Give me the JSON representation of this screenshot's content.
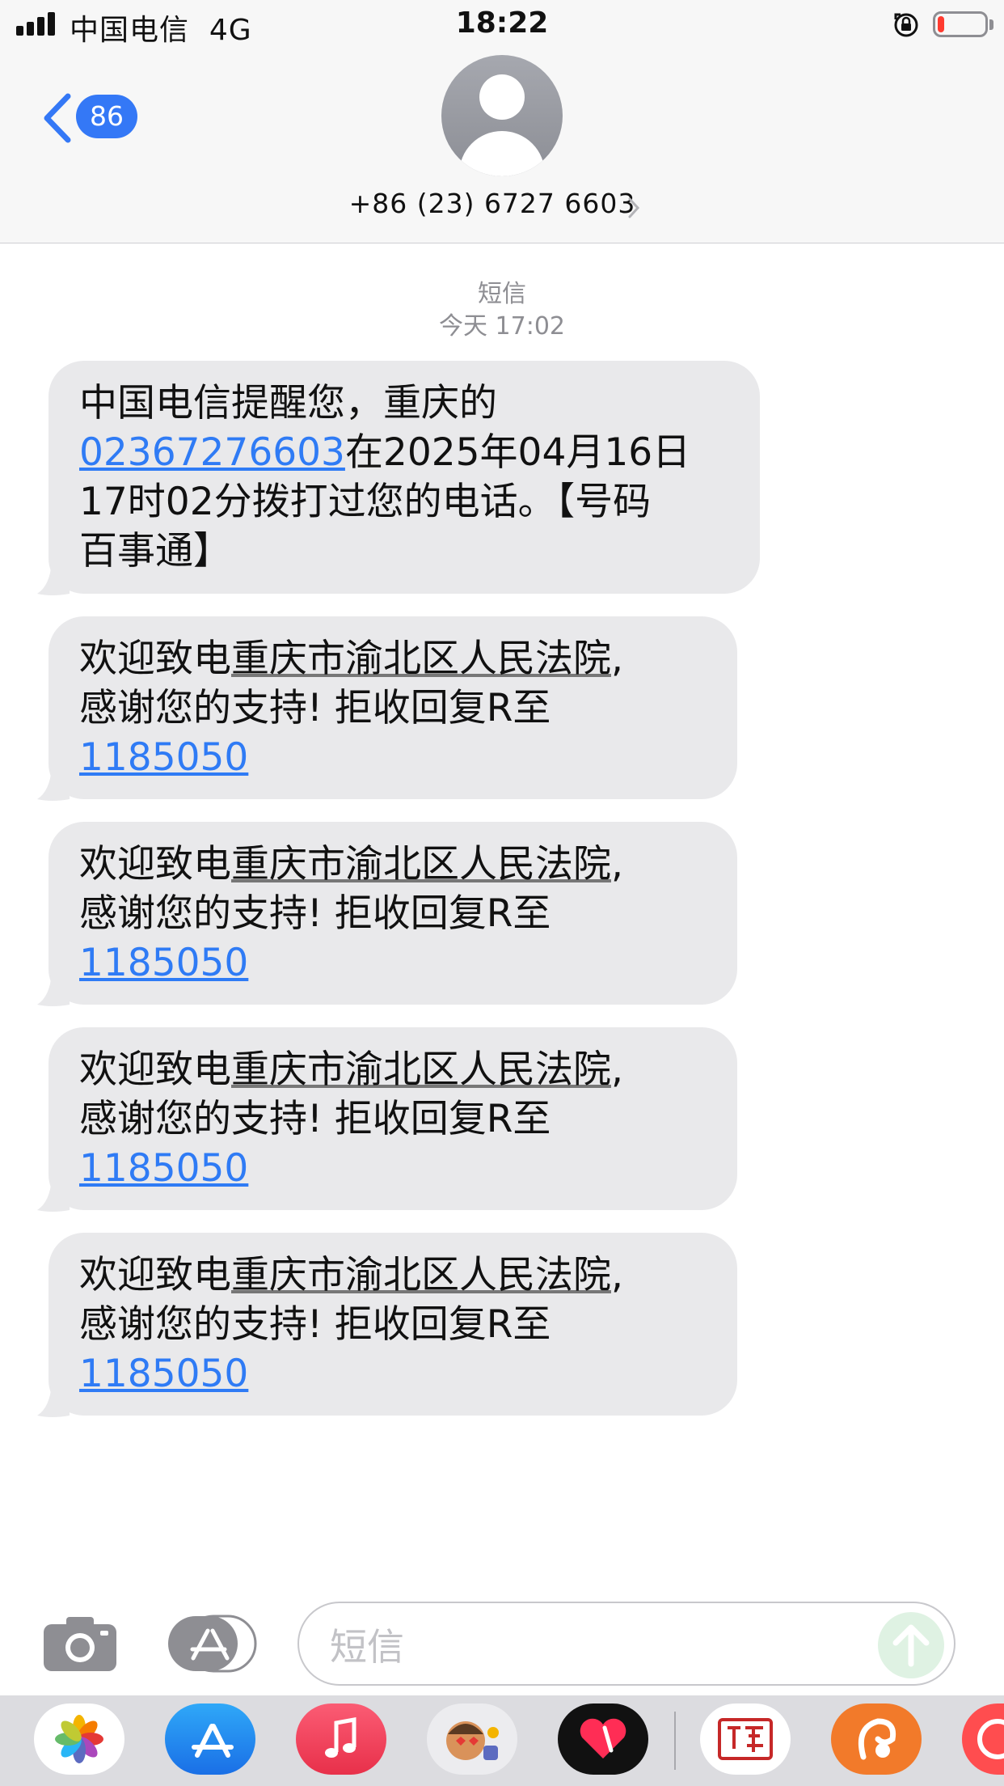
{
  "status_bar": {
    "carrier": "中国电信",
    "network": "4G",
    "time": "18:22",
    "battery_level": 0.15,
    "icons": [
      "signal-icon",
      "orientation-lock-icon",
      "battery-icon"
    ],
    "colors": {
      "battery_low": "#ff3b30"
    }
  },
  "header": {
    "back_badge": "86",
    "contact_number": "+86 (23) 6727 6603",
    "icons": [
      "back-chevron-icon",
      "avatar-icon",
      "chevron-right-icon"
    ],
    "colors": {
      "accent": "#3478f6"
    }
  },
  "conversation": {
    "type_label": "短信",
    "timestamp": "今天 17:02",
    "messages": [
      {
        "line1": "中国电信提醒您，重庆的",
        "link_number": "02367276603",
        "line2_rest": "在2025年04月16日",
        "line3": "17时02分拨打过您的电话。【号码",
        "line4": "百事通】"
      },
      {
        "prefix": "欢迎致电",
        "org": "重庆市渝北区人民法院",
        "suffix": ",",
        "line2": "感谢您的支持! 拒收回复R至",
        "link": "1185050"
      },
      {
        "prefix": "欢迎致电",
        "org": "重庆市渝北区人民法院",
        "suffix": ",",
        "line2": "感谢您的支持! 拒收回复R至",
        "link": "1185050"
      },
      {
        "prefix": "欢迎致电",
        "org": "重庆市渝北区人民法院",
        "suffix": ",",
        "line2": "感谢您的支持! 拒收回复R至",
        "link": "1185050"
      },
      {
        "prefix": "欢迎致电",
        "org": "重庆市渝北区人民法院",
        "suffix": ",",
        "line2": "感谢您的支持! 拒收回复R至",
        "link": "1185050"
      }
    ],
    "colors": {
      "bubble": "#e9e9eb",
      "link": "#2f7bf5"
    }
  },
  "compose": {
    "placeholder": "短信",
    "icons": [
      "camera-icon",
      "app-store-icon",
      "send-arrow-icon"
    ]
  },
  "app_drawer": {
    "apps": [
      "photos-app-icon",
      "app-store-app-icon",
      "music-app-icon",
      "memoji-app-icon",
      "digital-touch-app-icon",
      "stamp-app-icon",
      "squirrel-app-icon",
      "partial-app-icon"
    ]
  }
}
